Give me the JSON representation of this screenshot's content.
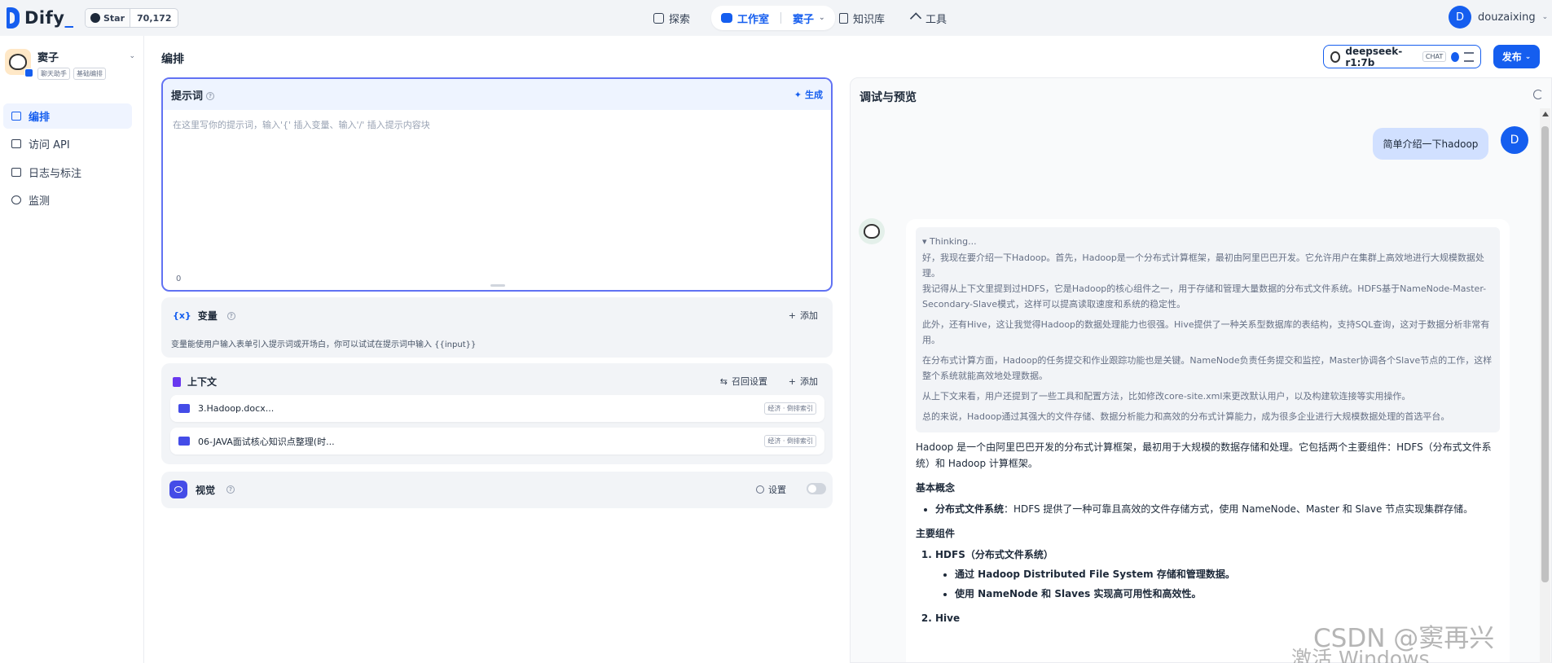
{
  "topbar": {
    "logo": "Dify",
    "star_label": "Star",
    "star_count": "70,172",
    "nav": {
      "explore": "探索",
      "studio": "工作室",
      "studio_app": "窦子",
      "knowledge": "知识库",
      "tools": "工具"
    },
    "user_initial": "D",
    "user_name": "douzaixing"
  },
  "sidebar": {
    "app_name": "窦子",
    "tags": [
      "聊天助手",
      "基础编排"
    ],
    "items": [
      {
        "label": "编排",
        "icon": "layout-icon",
        "active": true
      },
      {
        "label": "访问 API",
        "icon": "terminal-icon",
        "active": false
      },
      {
        "label": "日志与标注",
        "icon": "file-list-icon",
        "active": false
      },
      {
        "label": "监测",
        "icon": "monitor-icon",
        "active": false
      }
    ]
  },
  "main": {
    "title": "编排",
    "model": {
      "name": "deepseek-r1:7b",
      "mode": "CHAT"
    },
    "publish": "发布",
    "prompt": {
      "title": "提示词",
      "generate": "生成",
      "placeholder": "在这里写你的提示词，输入'{' 插入变量、输入'/' 插入提示内容块",
      "count": "0"
    },
    "variables": {
      "title": "变量",
      "add": "添加",
      "desc": "变量能使用户输入表单引入提示词或开场白，你可以试试在提示词中输入 {{input}}"
    },
    "context": {
      "title": "上下文",
      "recall": "召回设置",
      "add": "添加",
      "items": [
        {
          "name": "3.Hadoop.docx...",
          "tag": "经济 · 倒排索引"
        },
        {
          "name": "06-JAVA面试核心知识点整理(时...",
          "tag": "经济 · 倒排索引"
        }
      ]
    },
    "vision": {
      "title": "视觉",
      "settings": "设置",
      "enabled": false
    }
  },
  "debug": {
    "title": "调试与预览",
    "user_message": "简单介绍一下hadoop",
    "user_initial": "D",
    "thinking_label": "Thinking...",
    "thinking": [
      "好，我现在要介绍一下Hadoop。首先，Hadoop是一个分布式计算框架，最初由阿里巴巴开发。它允许用户在集群上高效地进行大规模数据处理。",
      "我记得从上下文里提到过HDFS，它是Hadoop的核心组件之一，用于存储和管理大量数据的分布式文件系统。HDFS基于NameNode-Master-Secondary-Slave模式，这样可以提高读取速度和系统的稳定性。",
      "此外，还有Hive，这让我觉得Hadoop的数据处理能力也很强。Hive提供了一种关系型数据库的表结构，支持SQL查询，这对于数据分析非常有用。",
      "在分布式计算方面，Hadoop的任务提交和作业跟踪功能也是关键。NameNode负责任务提交和监控，Master协调各个Slave节点的工作，这样整个系统就能高效地处理数据。",
      "从上下文来看，用户还提到了一些工具和配置方法，比如修改core-site.xml来更改默认用户，以及构建软连接等实用操作。",
      "总的来说，Hadoop通过其强大的文件存储、数据分析能力和高效的分布式计算能力，成为很多企业进行大规模数据处理的首选平台。"
    ],
    "answer_intro": "Hadoop 是一个由阿里巴巴开发的分布式计算框架，最初用于大规模的数据存储和处理。它包括两个主要组件：HDFS（分布式文件系统）和 Hadoop 计算框架。",
    "section1": "基本概念",
    "concept_bold": "分布式文件系统",
    "concept_text": "：HDFS 提供了一种可靠且高效的文件存储方式，使用 NameNode、Master 和 Slave 节点实现集群存储。",
    "section2": "主要组件",
    "comp1": "HDFS（分布式文件系统）",
    "comp1_items": [
      "通过 Hadoop Distributed File System 存储和管理数据。",
      "使用 NameNode 和 Slaves 实现高可用性和高效性。"
    ],
    "comp2": "Hive"
  },
  "watermark": "CSDN @窦再兴",
  "activate": "激活 Windows"
}
